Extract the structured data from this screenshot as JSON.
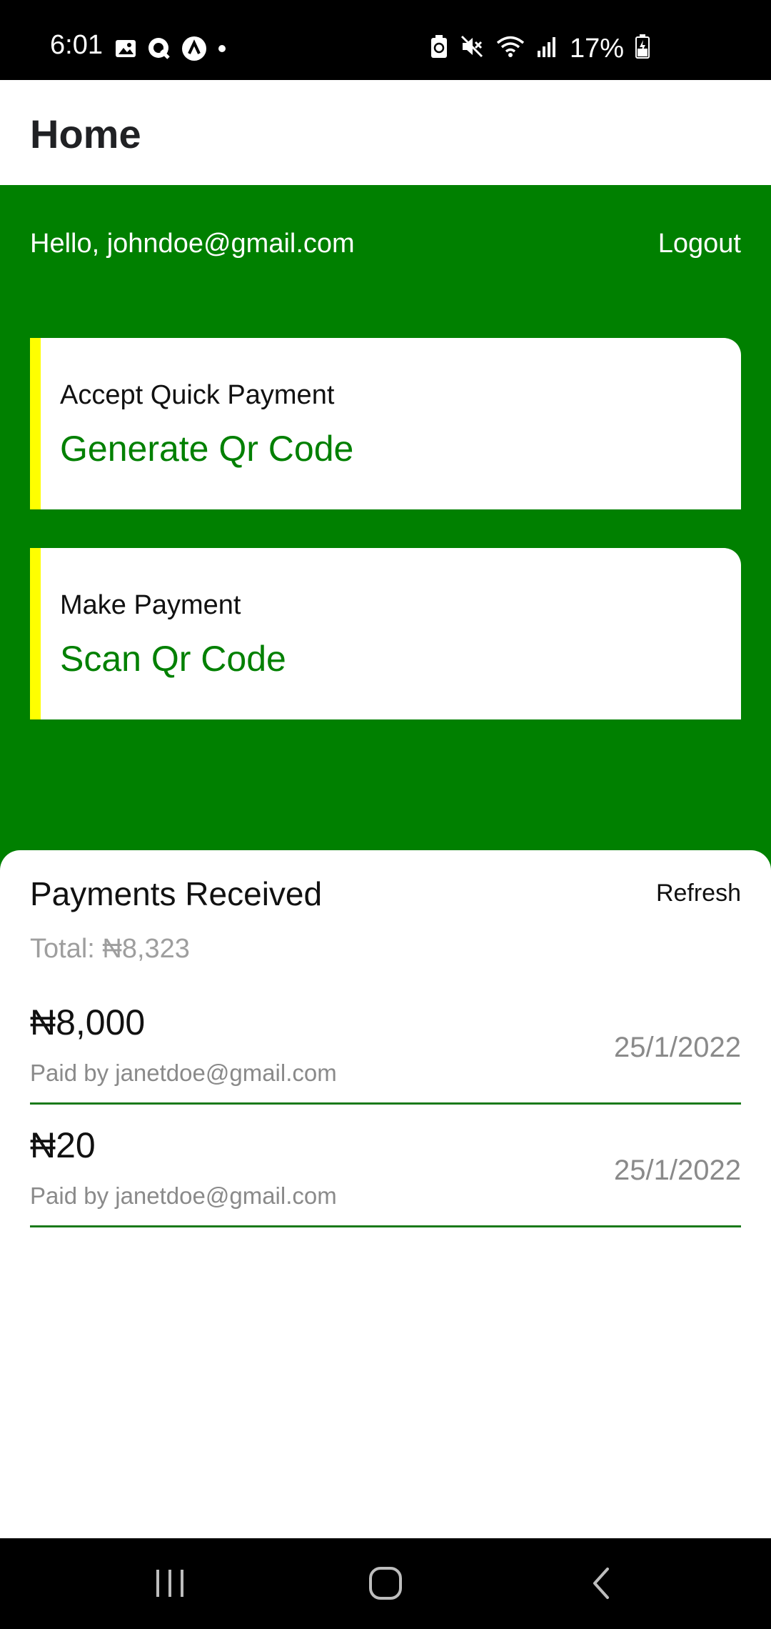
{
  "status_bar": {
    "time": "6:01",
    "battery": "17%",
    "left_icons": [
      "gallery-icon",
      "q-app-icon",
      "a-app-icon",
      "dot-icon"
    ],
    "right_icons": [
      "battery-saver-icon",
      "mute-icon",
      "wifi-icon",
      "signal-icon",
      "battery-charging-icon"
    ]
  },
  "app_bar": {
    "title": "Home"
  },
  "header": {
    "greeting": "Hello, johndoe@gmail.com",
    "logout_label": "Logout"
  },
  "actions": [
    {
      "subtitle": "Accept Quick Payment",
      "title": "Generate Qr Code"
    },
    {
      "subtitle": "Make Payment",
      "title": "Scan Qr Code"
    }
  ],
  "payments": {
    "title": "Payments Received",
    "refresh_label": "Refresh",
    "total": "Total: ₦8,323",
    "items": [
      {
        "amount": "₦8,000",
        "payer": "Paid by janetdoe@gmail.com",
        "date": "25/1/2022"
      },
      {
        "amount": "₦20",
        "payer": "Paid by janetdoe@gmail.com",
        "date": "25/1/2022"
      }
    ]
  },
  "colors": {
    "primary_green": "#008000",
    "accent_yellow": "#ffff00",
    "divider_green": "#1a7a1a",
    "muted_text": "#8a8a8a"
  }
}
